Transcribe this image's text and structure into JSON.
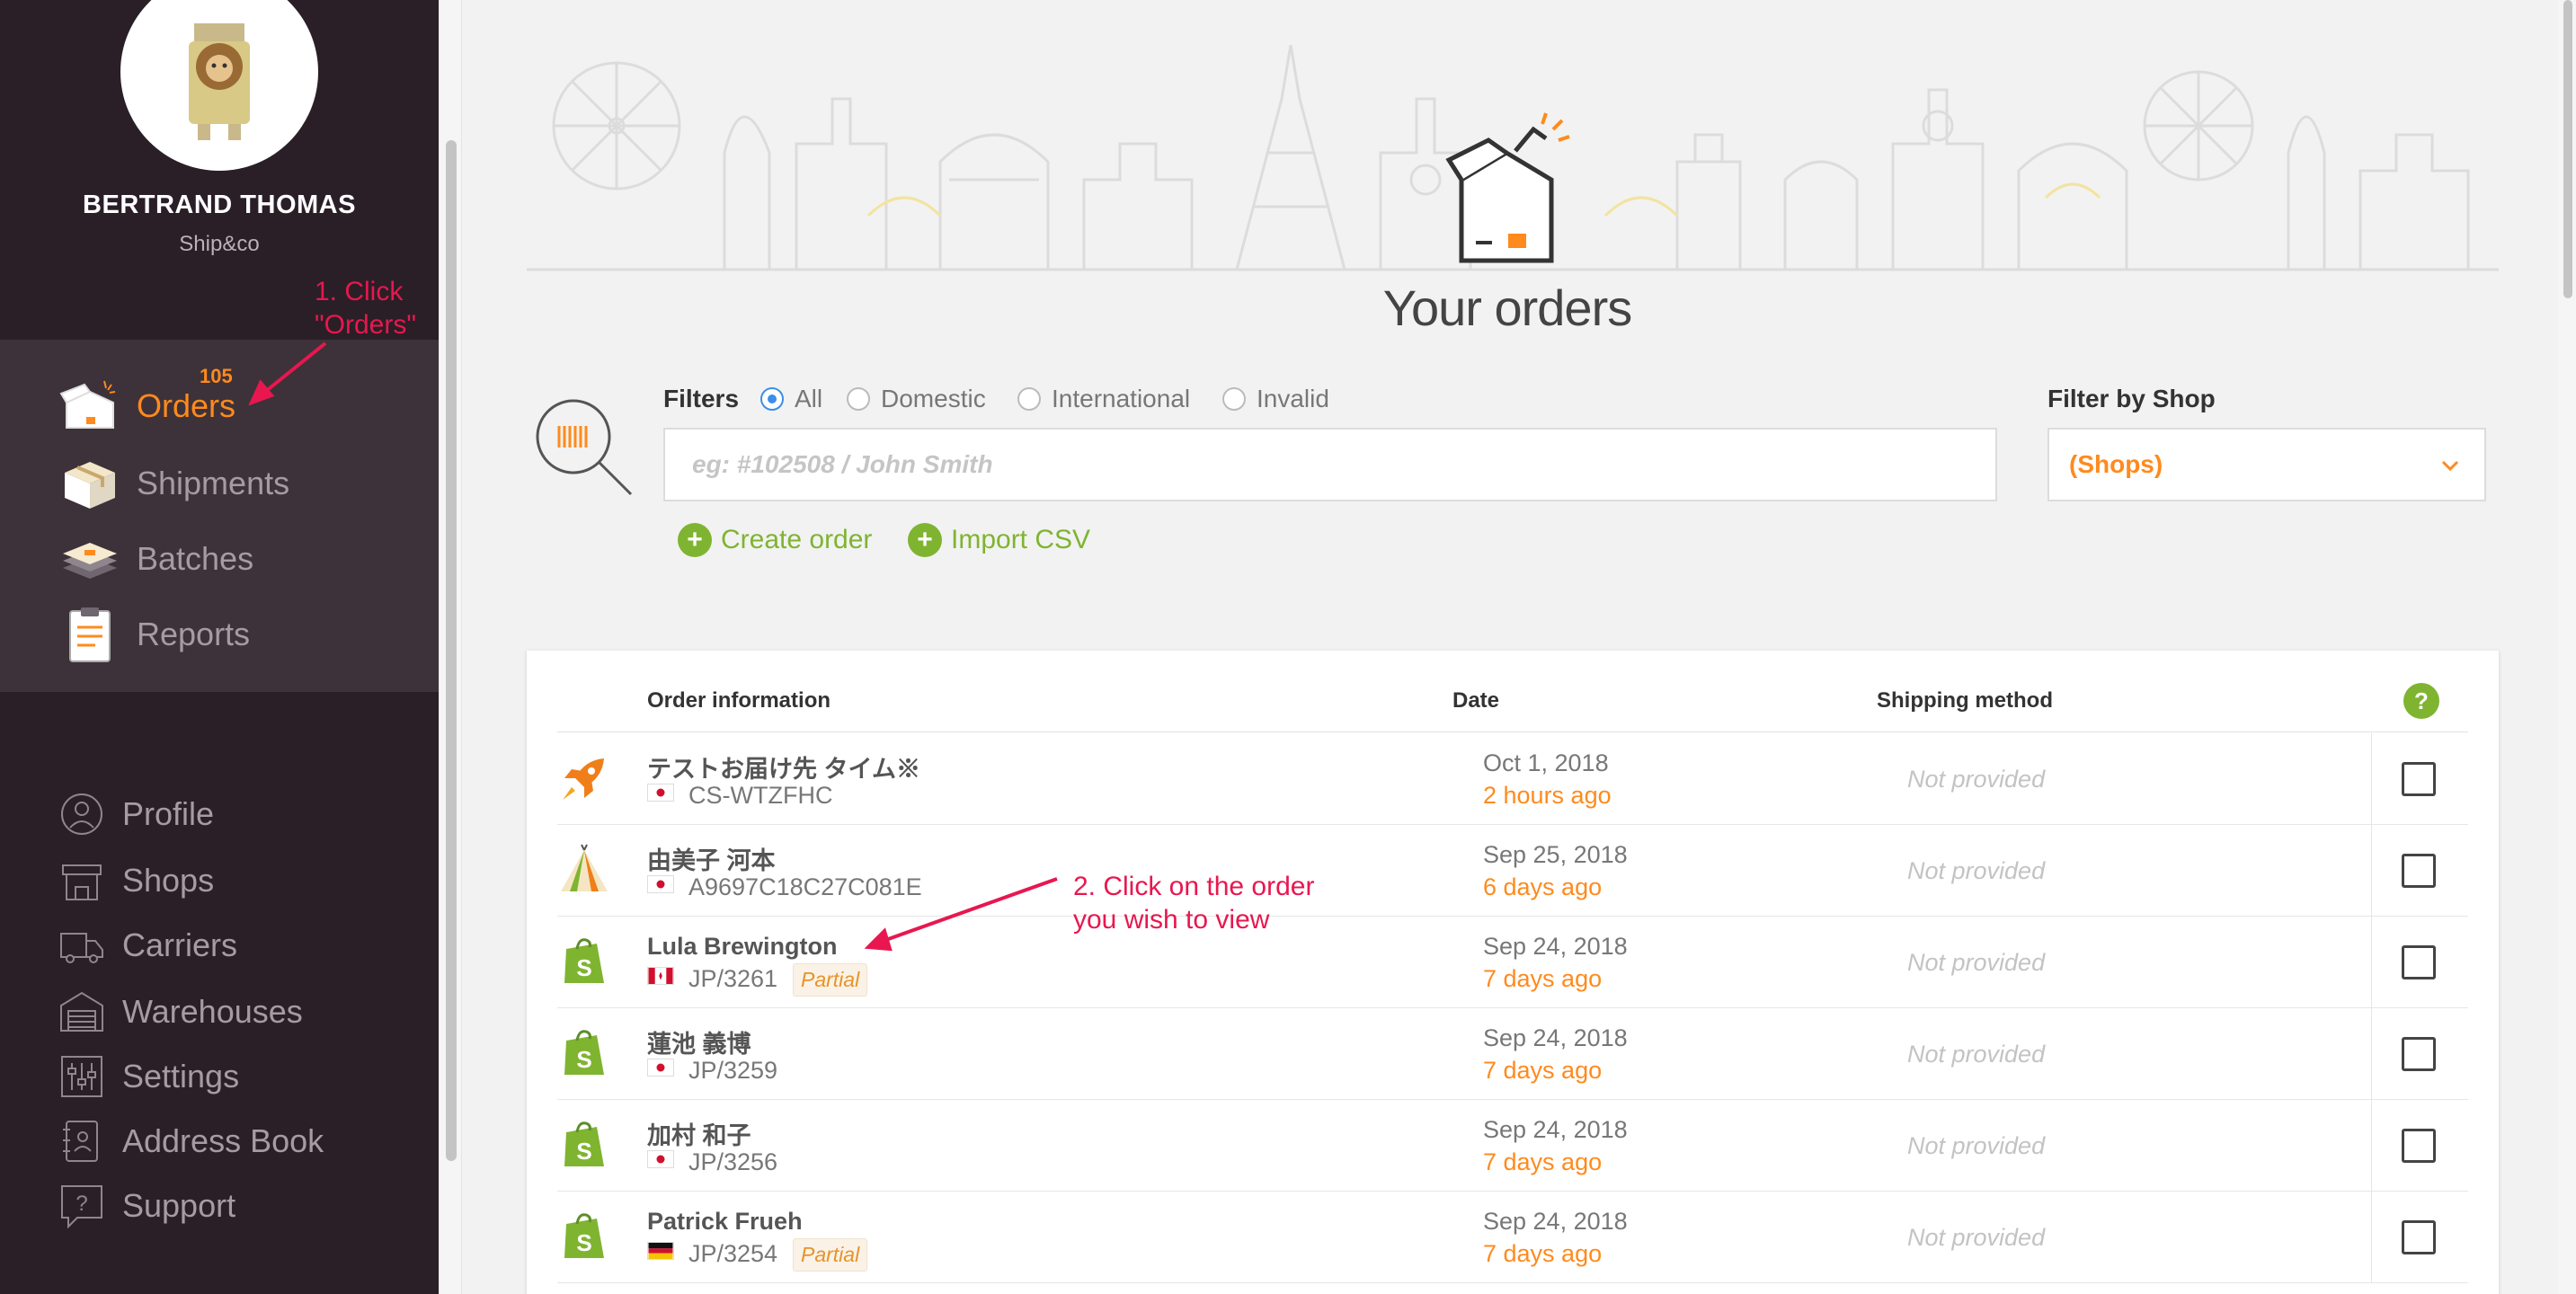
{
  "user": {
    "name": "BERTRAND THOMAS",
    "company": "Ship&co"
  },
  "nav": {
    "orders_badge": "105",
    "items": [
      {
        "label": "Orders",
        "icon": "orders-box-icon",
        "active": true
      },
      {
        "label": "Shipments",
        "icon": "shipment-box-icon"
      },
      {
        "label": "Batches",
        "icon": "batches-stack-icon"
      },
      {
        "label": "Reports",
        "icon": "clipboard-icon"
      }
    ],
    "sub_items": [
      {
        "label": "Profile",
        "icon": "profile-icon"
      },
      {
        "label": "Shops",
        "icon": "shop-icon"
      },
      {
        "label": "Carriers",
        "icon": "truck-icon"
      },
      {
        "label": "Warehouses",
        "icon": "warehouse-icon"
      },
      {
        "label": "Settings",
        "icon": "sliders-icon"
      },
      {
        "label": "Address Book",
        "icon": "address-book-icon"
      },
      {
        "label": "Support",
        "icon": "help-bubble-icon"
      }
    ]
  },
  "annotations": {
    "step1_line1": "1. Click",
    "step1_line2": "\"Orders\"",
    "step2_line1": "2. Click on the order",
    "step2_line2": "you wish to view"
  },
  "main": {
    "title": "Your orders",
    "filters_label": "Filters",
    "filter_options": [
      "All",
      "Domestic",
      "International",
      "Invalid"
    ],
    "selected_filter": "All",
    "search_placeholder": "eg: #102508 / John Smith",
    "shop_filter_label": "Filter by Shop",
    "shop_filter_value": "(Shops)",
    "create_order": "Create order",
    "import_csv": "Import CSV"
  },
  "table": {
    "headers": [
      "Order information",
      "Date",
      "Shipping method"
    ],
    "help": "?",
    "rows": [
      {
        "icon": "rocket-icon",
        "name": "テストお届け先 タイム※",
        "flag": "jp",
        "id": "CS-WTZFHC",
        "badge": "",
        "date": "Oct 1, 2018",
        "ago": "2 hours ago",
        "shipping": "Not provided"
      },
      {
        "icon": "tent-icon",
        "name": "由美子 河本",
        "flag": "jp",
        "id": "A9697C18C27C081E",
        "badge": "",
        "date": "Sep 25, 2018",
        "ago": "6 days ago",
        "shipping": "Not provided"
      },
      {
        "icon": "shopify-bag-icon",
        "name": "Lula Brewington",
        "flag": "ca",
        "id": "JP/3261",
        "badge": "Partial",
        "date": "Sep 24, 2018",
        "ago": "7 days ago",
        "shipping": "Not provided"
      },
      {
        "icon": "shopify-bag-icon",
        "name": "蓮池 義博",
        "flag": "jp",
        "id": "JP/3259",
        "badge": "",
        "date": "Sep 24, 2018",
        "ago": "7 days ago",
        "shipping": "Not provided"
      },
      {
        "icon": "shopify-bag-icon",
        "name": "加村 和子",
        "flag": "jp",
        "id": "JP/3256",
        "badge": "",
        "date": "Sep 24, 2018",
        "ago": "7 days ago",
        "shipping": "Not provided"
      },
      {
        "icon": "shopify-bag-icon",
        "name": "Patrick Frueh",
        "flag": "de",
        "id": "JP/3254",
        "badge": "Partial",
        "date": "Sep 24, 2018",
        "ago": "7 days ago",
        "shipping": "Not provided"
      }
    ]
  },
  "colors": {
    "accent": "#ff8a1d",
    "sidebar": "#2a1f27",
    "green": "#7fb431",
    "annotation": "#e8174f"
  }
}
